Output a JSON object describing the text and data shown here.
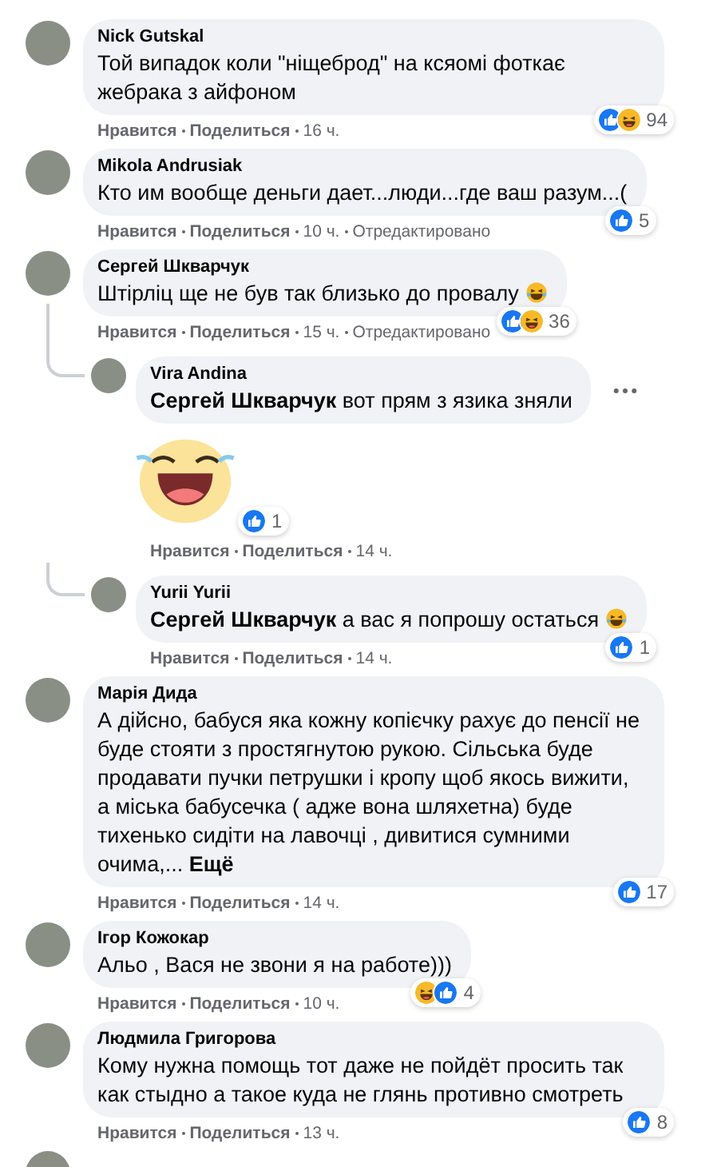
{
  "comments": [
    {
      "author": "Nick Gutskal",
      "text": "Той випадок коли \"ніщеброд\" на ксяомі фоткає жебрака з айфоном",
      "trailing_emoji": false,
      "reactions": {
        "types": [
          {
            "kind": "like"
          },
          {
            "kind": "haha"
          }
        ],
        "count": "94"
      },
      "actions": {
        "like": "Нравится",
        "share": "Поделиться",
        "time": "16 ч."
      }
    },
    {
      "author": "Mikola Andrusiak",
      "text": "Кто им вообще деньги дает...люди...где ваш разум...(",
      "trailing_emoji": false,
      "reactions": {
        "types": [
          {
            "kind": "like"
          }
        ],
        "count": "5"
      },
      "actions": {
        "like": "Нравится",
        "share": "Поделиться",
        "time": "10 ч.",
        "edited": "Отредактировано"
      }
    },
    {
      "author": "Сергей Шкварчук",
      "text": "Штірліц ще не був так близько до провалу",
      "trailing_emoji": true,
      "reactions": {
        "types": [
          {
            "kind": "like"
          },
          {
            "kind": "haha"
          }
        ],
        "count": "36"
      },
      "actions": {
        "like": "Нравится",
        "share": "Поделиться",
        "time": "15 ч.",
        "edited": "Отредактировано"
      },
      "replies": [
        {
          "author": "Vira Andina",
          "text": "**Сергей Шкварчук** вот прям з язика зняли",
          "trailing_emoji": false,
          "menu": true,
          "sticker": {
            "reactions": {
              "types": [
                {
                  "kind": "like"
                }
              ],
              "count": "1"
            }
          },
          "actions": {
            "like": "Нравится",
            "share": "Поделиться",
            "time": "14 ч."
          }
        },
        {
          "author": "Yurii Yurii",
          "text": "**Сергей Шкварчук** а вас я попрошу остаться",
          "trailing_emoji": true,
          "menu": false,
          "reactions": {
            "types": [
              {
                "kind": "like"
              }
            ],
            "count": "1"
          },
          "actions": {
            "like": "Нравится",
            "share": "Поделиться",
            "time": "14 ч."
          }
        }
      ]
    },
    {
      "author": "Марія Дида",
      "text": "А дійсно, бабуся яка кожну копієчку рахує до пенсії не буде стояти з простягнутою рукою. Сільська буде продавати пучки петрушки і кропу щоб якось вижити, а міська бабусечка ( адже вона шляхетна) буде тихенько сидіти на лавочці , дивитися сумними очима,...",
      "more": "Ещё",
      "trailing_emoji": false,
      "reactions": {
        "types": [
          {
            "kind": "like"
          }
        ],
        "count": "17"
      },
      "actions": {
        "like": "Нравится",
        "share": "Поделиться",
        "time": "14 ч."
      }
    },
    {
      "author": "Ігор Кожокар",
      "text": "Альо , Вася не звони я на работе)))",
      "trailing_emoji": false,
      "reactions": {
        "types": [
          {
            "kind": "haha"
          },
          {
            "kind": "like"
          }
        ],
        "count": "4"
      },
      "actions": {
        "like": "Нравится",
        "share": "Поделиться",
        "time": "10 ч."
      }
    },
    {
      "author": "Людмила Григорова",
      "text": "Кому нужна помощь тот даже не пойдёт просить так как стыдно а такое куда не глянь противно смотреть",
      "trailing_emoji": false,
      "reactions": {
        "types": [
          {
            "kind": "like"
          }
        ],
        "count": "8"
      },
      "actions": {
        "like": "Нравится",
        "share": "Поделиться",
        "time": "13 ч."
      }
    }
  ],
  "next_comment_peek": true
}
